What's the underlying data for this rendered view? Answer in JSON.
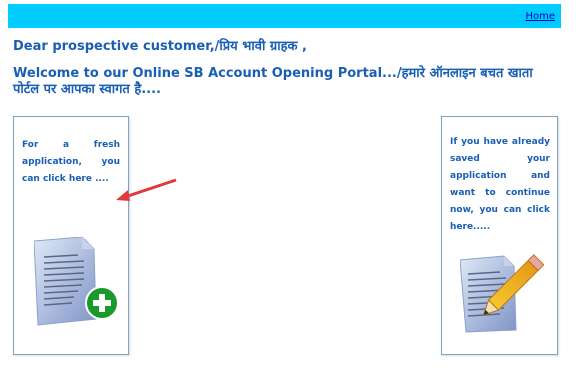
{
  "nav": {
    "home_label": "Home"
  },
  "header": {
    "greeting": "Dear prospective customer,/प्रिय भावी ग्राहक ,",
    "welcome": "Welcome to our Online SB Account Opening Portal.../हमारे ऑनलाइन बचत खाता पोर्टल पर आपका स्वागत है...."
  },
  "cards": {
    "fresh": {
      "text": "For a fresh application, you can click here ....",
      "icon": "new-document-icon"
    },
    "continue": {
      "text": "If you have already saved your application and want to continue now, you can click here.....",
      "icon": "edit-document-icon"
    }
  },
  "colors": {
    "topbar": "#00ccff",
    "heading": "#1a5fb4",
    "arrow": "#e0393b",
    "plus": "#1a9a2a"
  }
}
